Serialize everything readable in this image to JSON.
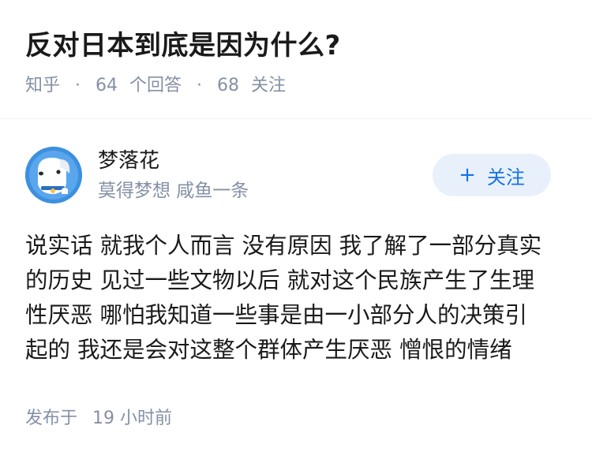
{
  "question": {
    "title": "反对日本到底是因为什么?",
    "source": "知乎",
    "answer_count": "64",
    "answer_label": "个回答",
    "follower_count": "68",
    "follower_label": "关注"
  },
  "answer": {
    "author": {
      "name": "梦落花",
      "bio": "莫得梦想 咸鱼一条",
      "avatar_icon": "cartoon-dog-avatar"
    },
    "follow_button": {
      "icon": "plus-icon",
      "label": "关注"
    },
    "content_lines": [
      "说实话 就我个人而言 没有原因 我了解了一部分真实",
      "的历史 见过一些文物以后 就对这个民族产生了生理",
      "性厌恶 哪怕我知道一些事是由一小部分人的决策引",
      "起的 我还是会对这整个群体产生厌恶 憎恨的情绪"
    ],
    "published_label": "发布于",
    "published_time": "19 小时前"
  },
  "colors": {
    "text_primary": "#1a1a1a",
    "text_secondary": "#8590a6",
    "accent_blue": "#1772e6",
    "button_bg": "#e8f1fb",
    "avatar_bg": "#3d8fe0"
  }
}
